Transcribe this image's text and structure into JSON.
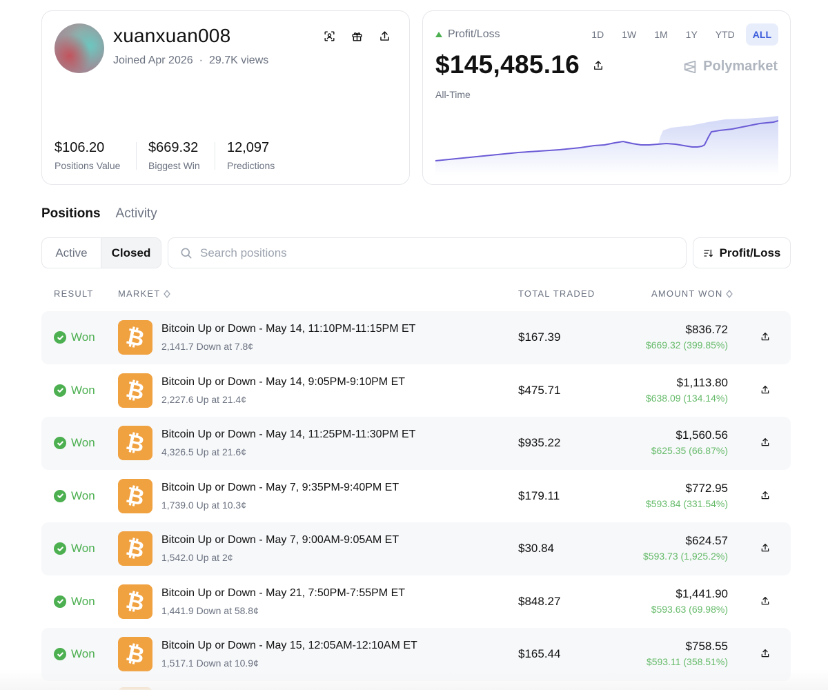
{
  "profile": {
    "username": "xuanxuan008",
    "joined": "Joined Apr 2026",
    "views": "29.7K views",
    "separator": "·",
    "stats": [
      {
        "value": "$106.20",
        "label": "Positions Value"
      },
      {
        "value": "$669.32",
        "label": "Biggest Win"
      },
      {
        "value": "12,097",
        "label": "Predictions"
      }
    ]
  },
  "pnl": {
    "label": "Profit/Loss",
    "value": "$145,485.16",
    "period": "All-Time",
    "brand": "Polymarket",
    "ranges": [
      "1D",
      "1W",
      "1M",
      "1Y",
      "YTD",
      "ALL"
    ],
    "active_range": "ALL",
    "trend_color": "#6b5bd6",
    "up_color": "#4caf50"
  },
  "tabs": {
    "positions": "Positions",
    "activity": "Activity"
  },
  "filter": {
    "active": "Active",
    "closed": "Closed",
    "selected": "Closed"
  },
  "search": {
    "placeholder": "Search positions",
    "value": ""
  },
  "sort": {
    "label": "Profit/Loss"
  },
  "table": {
    "headers": {
      "result": "RESULT",
      "market": "MARKET",
      "traded": "TOTAL TRADED",
      "won": "AMOUNT WON"
    },
    "rows": [
      {
        "result": "Won",
        "title": "Bitcoin Up or Down - May 14, 11:10PM-11:15PM ET",
        "sub": "2,141.7 Down at 7.8¢",
        "traded": "$167.39",
        "amount": "$836.72",
        "gain": "$669.32 (399.85%)"
      },
      {
        "result": "Won",
        "title": "Bitcoin Up or Down - May 14, 9:05PM-9:10PM ET",
        "sub": "2,227.6 Up at 21.4¢",
        "traded": "$475.71",
        "amount": "$1,113.80",
        "gain": "$638.09 (134.14%)"
      },
      {
        "result": "Won",
        "title": "Bitcoin Up or Down - May 14, 11:25PM-11:30PM ET",
        "sub": "4,326.5 Up at 21.6¢",
        "traded": "$935.22",
        "amount": "$1,560.56",
        "gain": "$625.35 (66.87%)"
      },
      {
        "result": "Won",
        "title": "Bitcoin Up or Down - May 7, 9:35PM-9:40PM ET",
        "sub": "1,739.0 Up at 10.3¢",
        "traded": "$179.11",
        "amount": "$772.95",
        "gain": "$593.84 (331.54%)"
      },
      {
        "result": "Won",
        "title": "Bitcoin Up or Down - May 7, 9:00AM-9:05AM ET",
        "sub": "1,542.0 Up at 2¢",
        "traded": "$30.84",
        "amount": "$624.57",
        "gain": "$593.73 (1,925.2%)"
      },
      {
        "result": "Won",
        "title": "Bitcoin Up or Down - May 21, 7:50PM-7:55PM ET",
        "sub": "1,441.9 Down at 58.8¢",
        "traded": "$848.27",
        "amount": "$1,441.90",
        "gain": "$593.63 (69.98%)"
      },
      {
        "result": "Won",
        "title": "Bitcoin Up or Down - May 15, 12:05AM-12:10AM ET",
        "sub": "1,517.1 Down at 10.9¢",
        "traded": "$165.44",
        "amount": "$758.55",
        "gain": "$593.11 (358.51%)"
      }
    ],
    "coin_glyph": "₿"
  }
}
